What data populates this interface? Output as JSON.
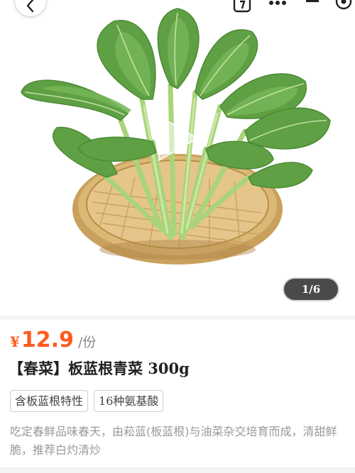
{
  "gallery": {
    "pager_text": "1/6",
    "image_alt": "produce-photo-greens-in-bamboo-basket",
    "icons": {
      "back": "chevron-left-icon",
      "share": "share-icon",
      "more": "more-dots-icon",
      "menu": "menu-icon",
      "target": "target-icon",
      "play": "play-icon"
    }
  },
  "product": {
    "price_currency": "¥",
    "price_value": "12.9",
    "price_unit": "/份",
    "title": "【春菜】板蓝根青菜 300g",
    "tags": [
      "含板蓝根特性",
      "16种氨基酸"
    ],
    "description": "吃定春鲜品味春天，由菘蓝(板蓝根)与油菜杂交培育而成，清甜鲜脆，推荐白灼清炒"
  },
  "colors": {
    "price": "#ff5a1f",
    "title": "#222222",
    "description": "#999999",
    "pager_bg": "#4a4a4a"
  }
}
